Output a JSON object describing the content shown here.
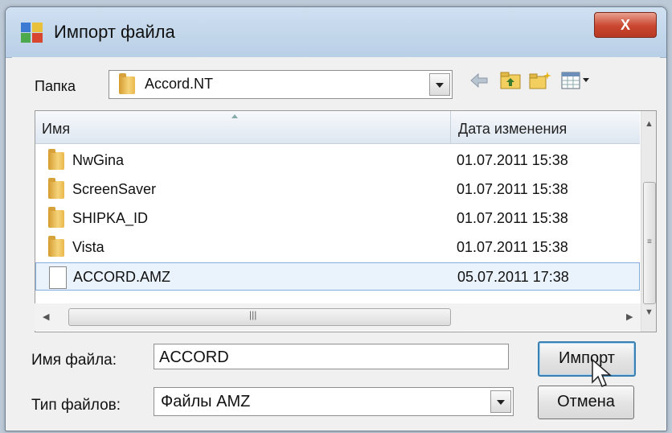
{
  "window": {
    "title": "Импорт файла",
    "close_label": "X"
  },
  "folder_bar": {
    "label": "Папка",
    "current_folder": "Accord.NT"
  },
  "toolbar": {
    "icons": [
      "back-arrow-icon",
      "up-folder-icon",
      "new-folder-icon",
      "view-menu-icon"
    ]
  },
  "list": {
    "columns": [
      "Имя",
      "Дата изменения"
    ],
    "rows": [
      {
        "name": "NwGina",
        "date": "01.07.2011 15:38",
        "type": "folder"
      },
      {
        "name": "ScreenSaver",
        "date": "01.07.2011 15:38",
        "type": "folder"
      },
      {
        "name": "SHIPKA_ID",
        "date": "01.07.2011 15:38",
        "type": "folder"
      },
      {
        "name": "Vista",
        "date": "01.07.2011 15:38",
        "type": "folder"
      },
      {
        "name": "ACCORD.AMZ",
        "date": "05.07.2011 17:38",
        "type": "file",
        "selected": true
      }
    ]
  },
  "filename": {
    "label": "Имя файла:",
    "value": "ACCORD"
  },
  "filetype": {
    "label": "Тип файлов:",
    "value": "Файлы AMZ"
  },
  "buttons": {
    "import": "Импорт",
    "cancel": "Отмена"
  }
}
